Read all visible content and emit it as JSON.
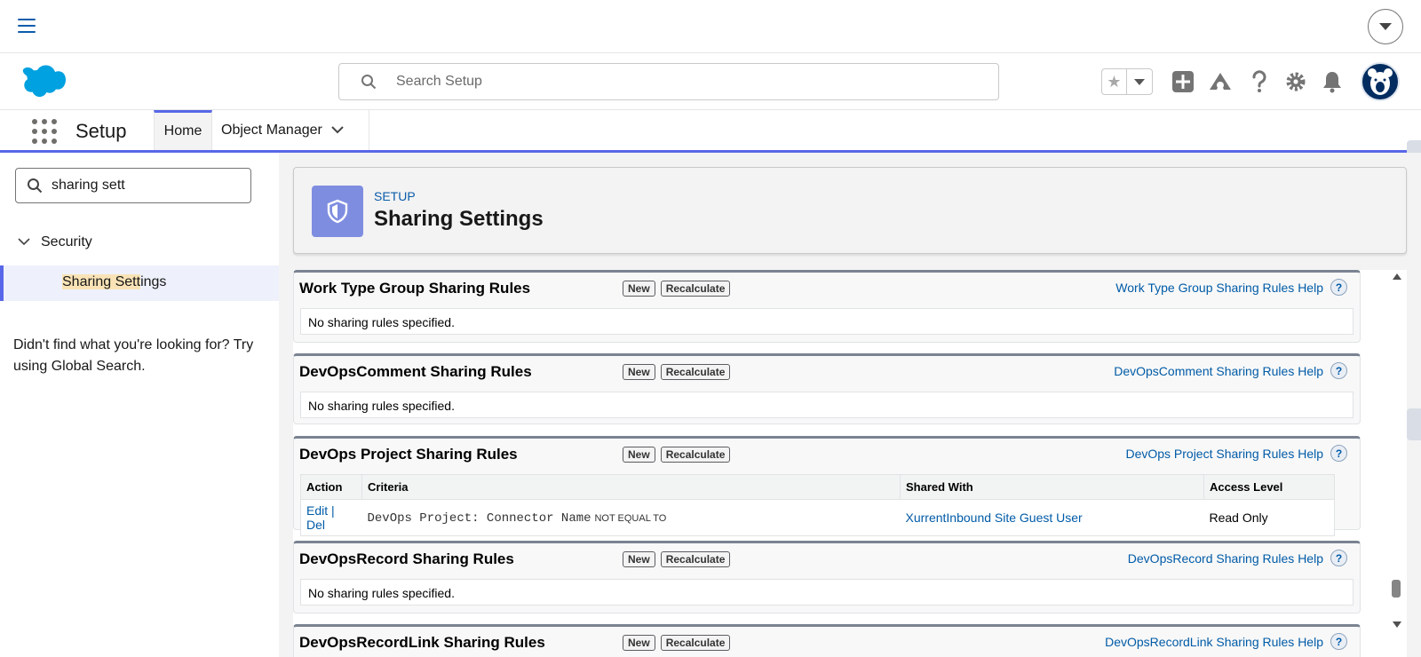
{
  "topbar": {
    "menu_icon": "hamburger-icon"
  },
  "header": {
    "search_placeholder": "Search Setup",
    "icons": [
      "star-icon",
      "add-icon",
      "trailhead-icon",
      "help-icon",
      "gear-icon",
      "bell-icon",
      "avatar"
    ]
  },
  "contextbar": {
    "app_name": "Setup",
    "tabs": [
      {
        "label": "Home"
      },
      {
        "label": "Object Manager"
      }
    ]
  },
  "sidebar": {
    "quickfind_value": "sharing sett",
    "section": "Security",
    "item_highlight": "Sharing Sett",
    "item_rest": "ings",
    "not_found": "Didn't find what you're looking for? Try using Global Search."
  },
  "page": {
    "eyebrow": "SETUP",
    "title": "Sharing Settings"
  },
  "sections": [
    {
      "title": "Work Type Group Sharing Rules",
      "new": "New",
      "recalc": "Recalculate",
      "help": "Work Type Group Sharing Rules Help",
      "empty": "No sharing rules specified."
    },
    {
      "title": "DevOpsComment Sharing Rules",
      "new": "New",
      "recalc": "Recalculate",
      "help": "DevOpsComment Sharing Rules Help",
      "empty": "No sharing rules specified."
    },
    {
      "title": "DevOps Project Sharing Rules",
      "new": "New",
      "recalc": "Recalculate",
      "help": "DevOps Project Sharing Rules Help",
      "table": {
        "headers": [
          "Action",
          "Criteria",
          "Shared With",
          "Access Level"
        ],
        "row": {
          "edit": "Edit",
          "sep": "|",
          "del": "Del",
          "criteria_field": "DevOps Project: Connector Name",
          "criteria_op": "NOT EQUAL TO",
          "shared_with": "XurrentInbound Site Guest User",
          "access": "Read Only"
        }
      }
    },
    {
      "title": "DevOpsRecord Sharing Rules",
      "new": "New",
      "recalc": "Recalculate",
      "help": "DevOpsRecord Sharing Rules Help",
      "empty": "No sharing rules specified."
    },
    {
      "title": "DevOpsRecordLink Sharing Rules",
      "new": "New",
      "recalc": "Recalculate",
      "help": "DevOpsRecordLink Sharing Rules Help"
    }
  ],
  "help_glyph": "?"
}
